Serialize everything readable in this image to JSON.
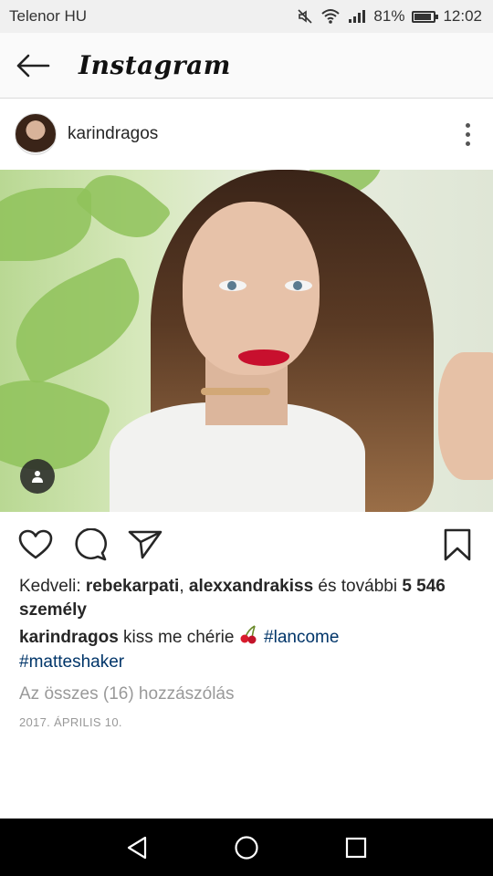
{
  "status_bar": {
    "carrier": "Telenor HU",
    "battery": "81%",
    "battery_level": 0.81,
    "time": "12:02"
  },
  "header": {
    "title": "Instagram",
    "back_icon": "arrow-left-icon"
  },
  "post": {
    "username": "karindragos",
    "likes": {
      "prefix": "Kedveli: ",
      "user1": "rebekarpati",
      "separator": ", ",
      "user2": "alexxandrakiss",
      "middle": " és további ",
      "count": "5 546",
      "suffix": "személy"
    },
    "caption": {
      "author": "karindragos",
      "text": " kiss me chérie ",
      "hashtag1": "#lancome",
      "hashtag2": "#matteshaker"
    },
    "comments_link": "Az összes (16) hozzászólás",
    "date": "2017. ÁPRILIS 10."
  },
  "colors": {
    "hashtag": "#003569",
    "muted": "#999999",
    "text": "#262626"
  }
}
